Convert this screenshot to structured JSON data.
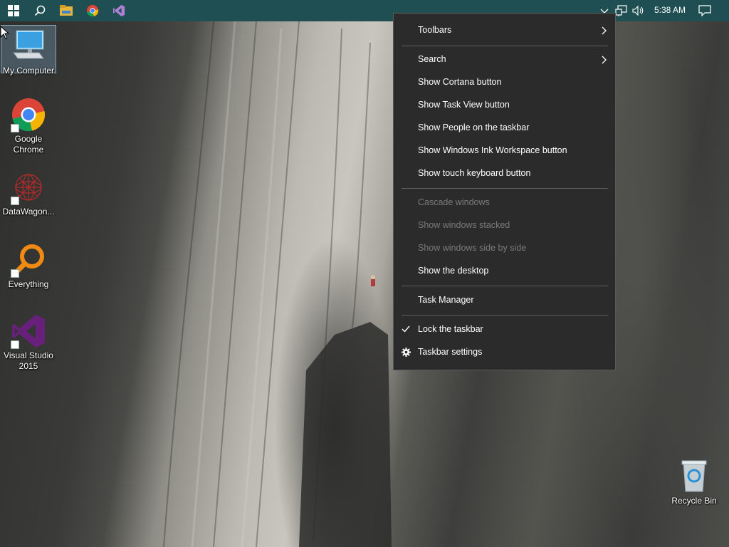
{
  "taskbar": {
    "clock": "5:38 AM",
    "pinned": [
      "start-icon",
      "search-icon",
      "file-explorer-icon",
      "chrome-icon",
      "visual-studio-icon"
    ],
    "tray": [
      "chevron-up-icon",
      "network-icon",
      "volume-icon",
      "action-center-icon"
    ]
  },
  "desktop": {
    "icons": [
      {
        "label": "My Computer",
        "icon": "computer-icon"
      },
      {
        "label": "Google Chrome",
        "icon": "chrome-icon"
      },
      {
        "label": "DataWagon...",
        "icon": "datawagon-icon"
      },
      {
        "label": "Everything",
        "icon": "everything-icon"
      },
      {
        "label": "Visual Studio 2015",
        "icon": "visual-studio-icon"
      }
    ],
    "recycle_bin": {
      "label": "Recycle Bin",
      "icon": "recycle-bin-icon"
    }
  },
  "context_menu": {
    "items": [
      {
        "label": "Toolbars",
        "submenu": true
      },
      {
        "label": "Search",
        "submenu": true
      },
      {
        "label": "Show Cortana button"
      },
      {
        "label": "Show Task View button"
      },
      {
        "label": "Show People on the taskbar"
      },
      {
        "label": "Show Windows Ink Workspace button"
      },
      {
        "label": "Show touch keyboard button"
      },
      {
        "label": "Cascade windows",
        "disabled": true
      },
      {
        "label": "Show windows stacked",
        "disabled": true
      },
      {
        "label": "Show windows side by side",
        "disabled": true
      },
      {
        "label": "Show the desktop"
      },
      {
        "label": "Task Manager"
      },
      {
        "label": "Lock the taskbar",
        "checked": true
      },
      {
        "label": "Taskbar settings",
        "icon": "gear-icon"
      }
    ]
  },
  "colors": {
    "taskbar": "#1f4e53",
    "menu_bg": "#2b2b2b",
    "menu_disabled": "#7a7a7a",
    "vs_purple": "#68217a"
  }
}
